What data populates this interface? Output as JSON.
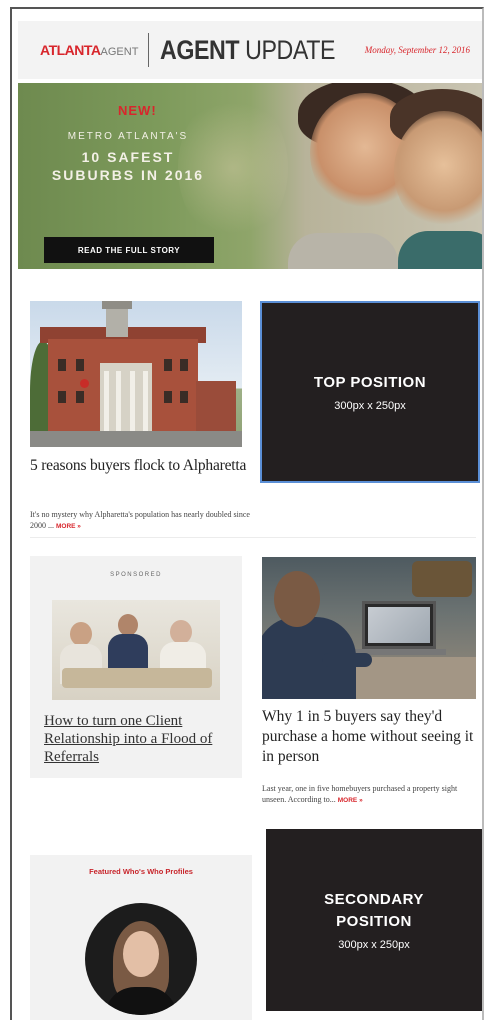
{
  "header": {
    "logo_main": "ATLANTA",
    "logo_sub": "AGENT",
    "title_bold": "AGENT",
    "title_rest": " UPDATE",
    "date": "Monday, September 12, 2016",
    "accent": "#d8262c"
  },
  "hero": {
    "badge": "NEW!",
    "line1": "METRO ATLANTA'S",
    "line2": "10 SAFEST",
    "line3": "SUBURBS IN 2016",
    "cta": "READ THE FULL STORY"
  },
  "article1": {
    "title": "5 reasons buyers flock to Alpharetta",
    "desc": "It's no mystery why Alpharetta's population has nearly doubled since 2000 ...",
    "more": "MORE »"
  },
  "ad_top": {
    "title": "TOP POSITION",
    "size": "300px x 250px",
    "border": "#5b8fd6"
  },
  "sponsored": {
    "label": "SPONSORED",
    "title": "How to turn one Client Relationship into a Flood of Referrals"
  },
  "article2": {
    "title": "Why 1 in 5 buyers say they'd purchase a home without seeing it in person",
    "desc": "Last year, one in five homebuyers purchased a property sight unseen. According to...",
    "more": "MORE »"
  },
  "featured": {
    "label": "Featured Who's Who Profiles"
  },
  "ad_secondary": {
    "title_line1": "SECONDARY",
    "title_line2": "POSITION",
    "size": "300px x 250px"
  }
}
